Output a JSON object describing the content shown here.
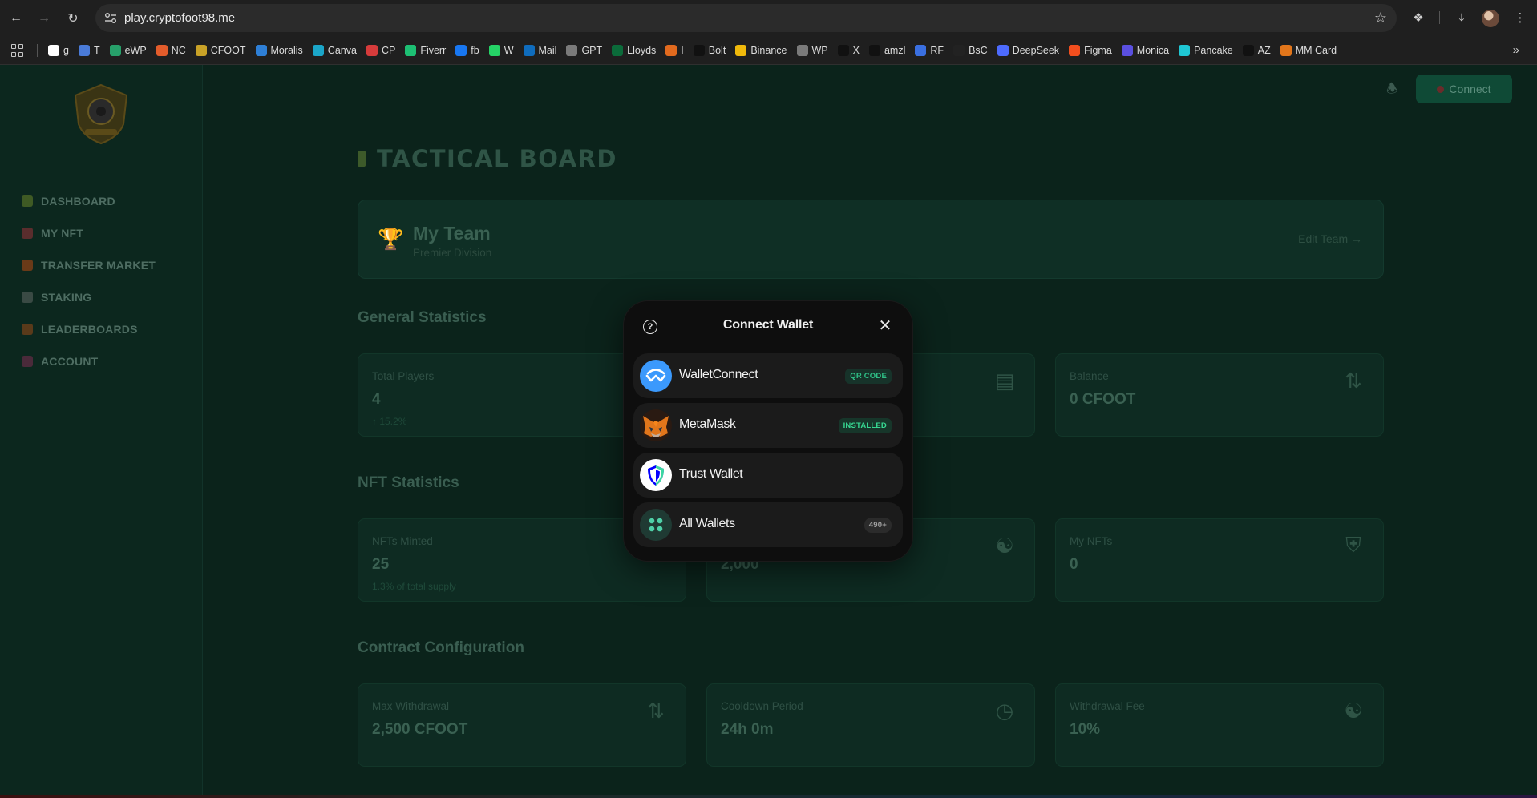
{
  "browser": {
    "url": "play.cryptofoot98.me",
    "bookmarks": [
      {
        "label": "g",
        "color": "#ffffff"
      },
      {
        "label": "T",
        "color": "#4a7bd8"
      },
      {
        "label": "eWP",
        "color": "#27a06a"
      },
      {
        "label": "NC",
        "color": "#e35c2b"
      },
      {
        "label": "CFOOT",
        "color": "#c9a227"
      },
      {
        "label": "Moralis",
        "color": "#2e7fd6"
      },
      {
        "label": "Canva",
        "color": "#1ba6c9"
      },
      {
        "label": "CP",
        "color": "#d63b3b"
      },
      {
        "label": "Fiverr",
        "color": "#1dbf73"
      },
      {
        "label": "fb",
        "color": "#1877f2"
      },
      {
        "label": "W",
        "color": "#25d366"
      },
      {
        "label": "Mail",
        "color": "#0f6cbd"
      },
      {
        "label": "GPT",
        "color": "#7a7a7a"
      },
      {
        "label": "Lloyds",
        "color": "#0b6b3a"
      },
      {
        "label": "I",
        "color": "#e26a1e"
      },
      {
        "label": "Bolt",
        "color": "#111111"
      },
      {
        "label": "Binance",
        "color": "#f0b90b"
      },
      {
        "label": "WP",
        "color": "#7a7a7a"
      },
      {
        "label": "X",
        "color": "#111111"
      },
      {
        "label": "amzl",
        "color": "#111111"
      },
      {
        "label": "RF",
        "color": "#3a6fe0"
      },
      {
        "label": "BsC",
        "color": "#222222"
      },
      {
        "label": "DeepSeek",
        "color": "#4d6bfe"
      },
      {
        "label": "Figma",
        "color": "#f24e1e"
      },
      {
        "label": "Monica",
        "color": "#5a4fe0"
      },
      {
        "label": "Pancake",
        "color": "#1fc7d4"
      },
      {
        "label": "AZ",
        "color": "#111111"
      },
      {
        "label": "MM Card",
        "color": "#e2761b"
      }
    ]
  },
  "app": {
    "sidebar": [
      {
        "label": "DASHBOARD",
        "color": "#3f5a24"
      },
      {
        "label": "MY NFT",
        "color": "#5a2d2d"
      },
      {
        "label": "TRANSFER MARKET",
        "color": "#6a3a18"
      },
      {
        "label": "STAKING",
        "color": "#3a4a44"
      },
      {
        "label": "LEADERBOARDS",
        "color": "#5a3a1a"
      },
      {
        "label": "ACCOUNT",
        "color": "#4a2a3a"
      }
    ],
    "connect_label": "Connect",
    "page_title": "TACTICAL BOARD",
    "team": {
      "name": "My Team",
      "division": "Premier Division",
      "edit": "Edit Team →"
    },
    "general_title": "General Statistics",
    "general": [
      {
        "label": "Total Players",
        "value": "4",
        "sub": "↑ 15.2%"
      },
      {
        "label": "",
        "value": "",
        "sub": ""
      },
      {
        "label": "Balance",
        "value": "0 CFOOT",
        "sub": ""
      }
    ],
    "nft_title": "NFT Statistics",
    "nft": [
      {
        "label": "NFTs Minted",
        "value": "25",
        "sub": "1.3% of total supply"
      },
      {
        "label": "",
        "value": "2,000",
        "sub": ""
      },
      {
        "label": "My NFTs",
        "value": "0",
        "sub": ""
      }
    ],
    "contract_title": "Contract Configuration",
    "contract": [
      {
        "label": "Max Withdrawal",
        "value": "2,500 CFOOT"
      },
      {
        "label": "Cooldown Period",
        "value": "24h 0m"
      },
      {
        "label": "Withdrawal Fee",
        "value": "10%"
      }
    ]
  },
  "modal": {
    "title": "Connect Wallet",
    "wallets": [
      {
        "name": "WalletConnect",
        "tag": "QR CODE"
      },
      {
        "name": "MetaMask",
        "tag": "INSTALLED"
      },
      {
        "name": "Trust Wallet",
        "tag": ""
      },
      {
        "name": "All Wallets",
        "tag": "490+"
      }
    ]
  }
}
